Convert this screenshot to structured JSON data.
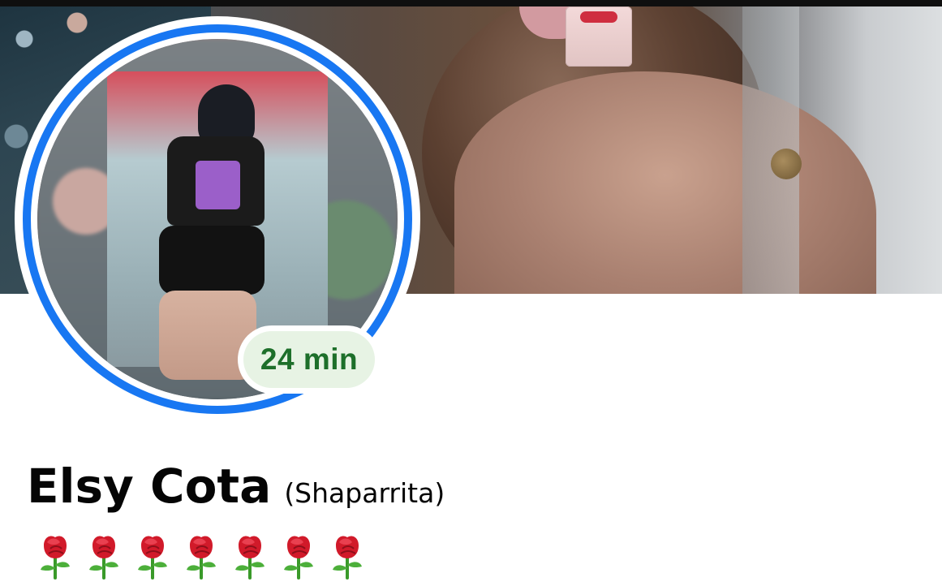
{
  "cover": {
    "icon": "cover-photo"
  },
  "profile": {
    "avatar_icon": "profile-photo",
    "ring_color": "#1877f2",
    "status_badge": "24 min",
    "status_color": "#1d6f2a",
    "name": "Elsy Cota",
    "alt_name": "(Shaparrita)"
  },
  "bio": {
    "emoji_icon": "rose-icon",
    "count": 7
  }
}
